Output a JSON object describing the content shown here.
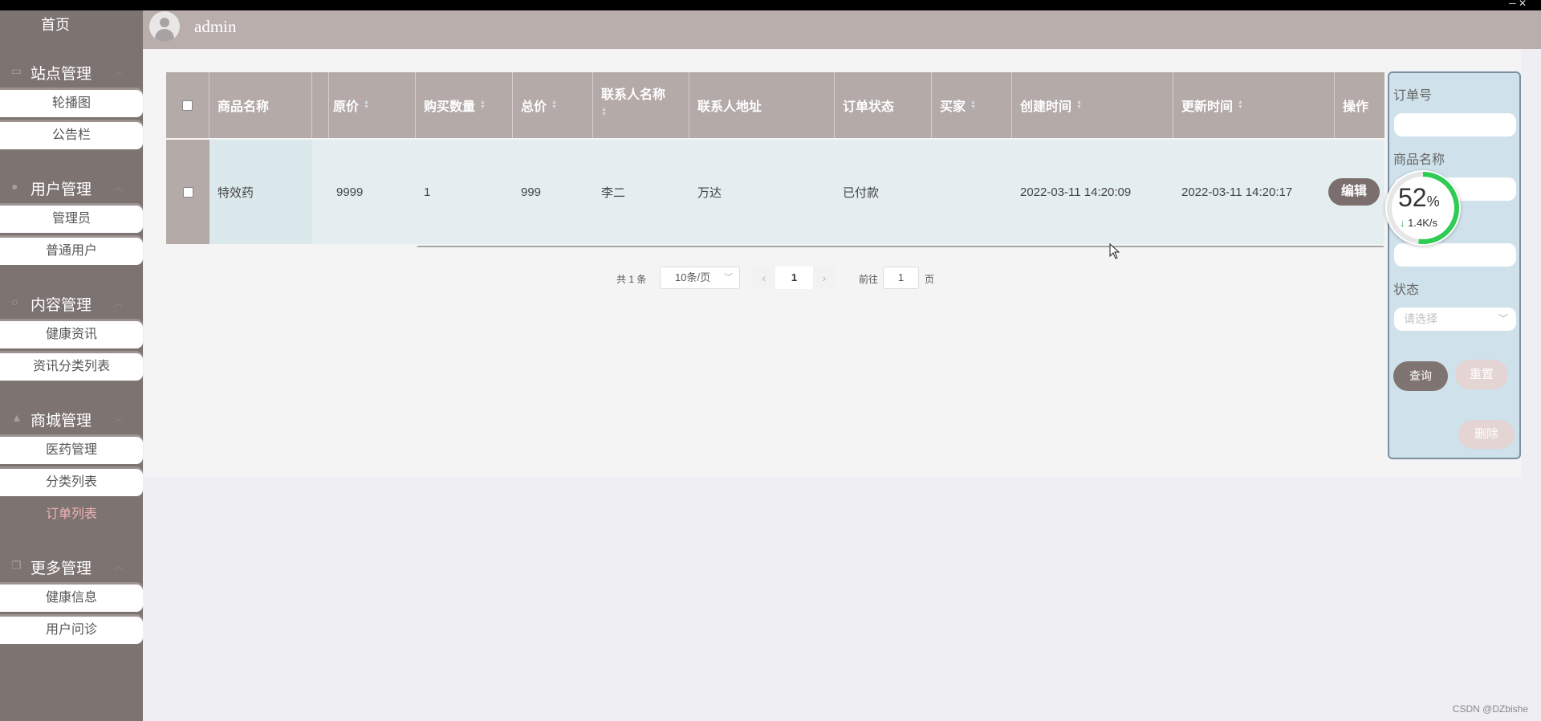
{
  "window": {
    "controls": "─  ✕"
  },
  "header": {
    "username": "admin"
  },
  "sidebar": {
    "home": "首页",
    "groups": [
      {
        "label": "站点管理",
        "icon": "monitor-icon",
        "items": [
          "轮播图",
          "公告栏"
        ]
      },
      {
        "label": "用户管理",
        "icon": "user-icon",
        "items": [
          "管理员",
          "普通用户"
        ]
      },
      {
        "label": "内容管理",
        "icon": "circle-icon",
        "items": [
          "健康资讯",
          "资讯分类列表"
        ]
      },
      {
        "label": "商城管理",
        "icon": "shop-icon",
        "items": [
          "医药管理",
          "分类列表",
          "订单列表"
        ]
      },
      {
        "label": "更多管理",
        "icon": "copy-icon",
        "items": [
          "健康信息",
          "用户问诊"
        ]
      }
    ],
    "active_item": "订单列表"
  },
  "table": {
    "columns": [
      "商品名称",
      "原价",
      "购买数量",
      "总价",
      "联系人名称",
      "联系人地址",
      "订单状态",
      "买家",
      "创建时间",
      "更新时间",
      "操作"
    ],
    "rows": [
      {
        "product_name": "特效药",
        "original_price": "9999",
        "quantity": "1",
        "total_price": "999",
        "contact_name": "李二",
        "contact_address": "万达",
        "status": "已付款",
        "buyer": "",
        "created_at": "2022-03-11 14:20:09",
        "updated_at": "2022-03-11 14:20:17",
        "action_label": "编辑"
      }
    ]
  },
  "pagination": {
    "total_text": "共 1 条",
    "page_size": "10条/页",
    "current_page": "1",
    "goto_label": "前往",
    "goto_value": "1",
    "page_suffix": "页"
  },
  "filter": {
    "order_no_label": "订单号",
    "product_name_label": "商品名称",
    "status_label": "状态",
    "status_placeholder": "请选择",
    "query_label": "查询",
    "reset_label": "重置",
    "delete_label": "删除"
  },
  "speed_widget": {
    "percent": "52",
    "percent_unit": "%",
    "rate": "1.4K/s",
    "progress": 0.52,
    "color": "#2ecc52"
  },
  "watermark": "CSDN @DZbishe",
  "colors": {
    "sidebar_bg": "#7d7371",
    "header_bg": "#b9aeac",
    "table_head_bg": "#b4aaa8",
    "active_text": "#f0b4b4",
    "filter_bg": "#cfe1ea"
  }
}
